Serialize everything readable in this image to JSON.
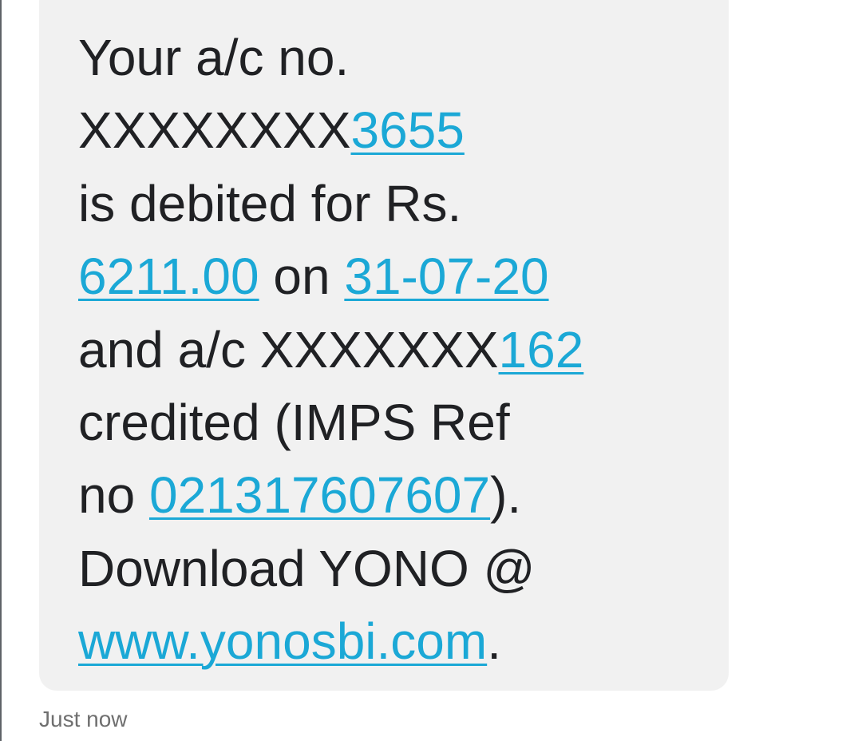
{
  "message": {
    "lines": [
      {
        "text": "Your a/c no."
      },
      {
        "prefix": "XXXXXXXX",
        "link": "3655"
      },
      {
        "text": "is debited for Rs."
      },
      {
        "link1": "6211.00",
        "middle": " on ",
        "link2": "31-07-20"
      },
      {
        "prefix": "and a/c XXXXXXX",
        "link": "162"
      },
      {
        "text": "credited (IMPS Ref"
      },
      {
        "prefix": "no ",
        "link": "021317607607",
        "suffix": ")."
      },
      {
        "text": "Download YONO @"
      },
      {
        "link": "www.yonosbi.com",
        "suffix": "."
      }
    ]
  },
  "timestamp": "Just now",
  "colors": {
    "bubble": "#f1f1f1",
    "link": "#1ba8d6",
    "text": "#202124",
    "timestamp": "#6f6f6f"
  }
}
